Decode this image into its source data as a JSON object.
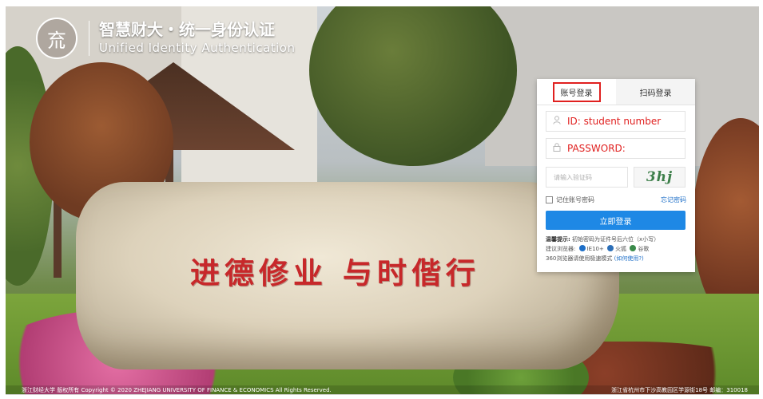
{
  "header": {
    "emblem_glyph": "㐬",
    "title": "智慧财大・统一身份认证",
    "subtitle": "Unified Identity Authentication"
  },
  "background": {
    "motto": "进德修业  与时偕行"
  },
  "login": {
    "tabs": [
      {
        "label": "账号登录",
        "active": true
      },
      {
        "label": "扫码登录",
        "active": false
      }
    ],
    "username_value": "ID:  student number",
    "password_value": "PASSWORD:",
    "captcha_placeholder": "请输入验证码",
    "captcha_text": "3hj",
    "remember_label": "记住账号密码",
    "forgot_label": "忘记密码",
    "submit_label": "立即登录",
    "tips": {
      "line1_prefix": "温馨提示:",
      "line1_text": "初始密码为证件号后六位（x小写）",
      "line2_prefix": "建议浏览器:",
      "browser1": "IE10+",
      "browser2": "火狐",
      "browser3": "谷歌",
      "line3_text": "360浏览器请使用极速模式",
      "line3_link": "(如何使用?)"
    },
    "icons": {
      "user": "user-icon",
      "lock": "lock-icon"
    },
    "colors": {
      "accent": "#1e88e5",
      "highlight_red": "#e0201f"
    }
  },
  "footer": {
    "left": "浙江财经大学 版权所有 Copyright © 2020 ZHEJIANG UNIVERSITY OF FINANCE & ECONOMICS All Rights Reserved.",
    "right": "浙江省杭州市下沙高教园区学源街18号 邮编：310018"
  }
}
